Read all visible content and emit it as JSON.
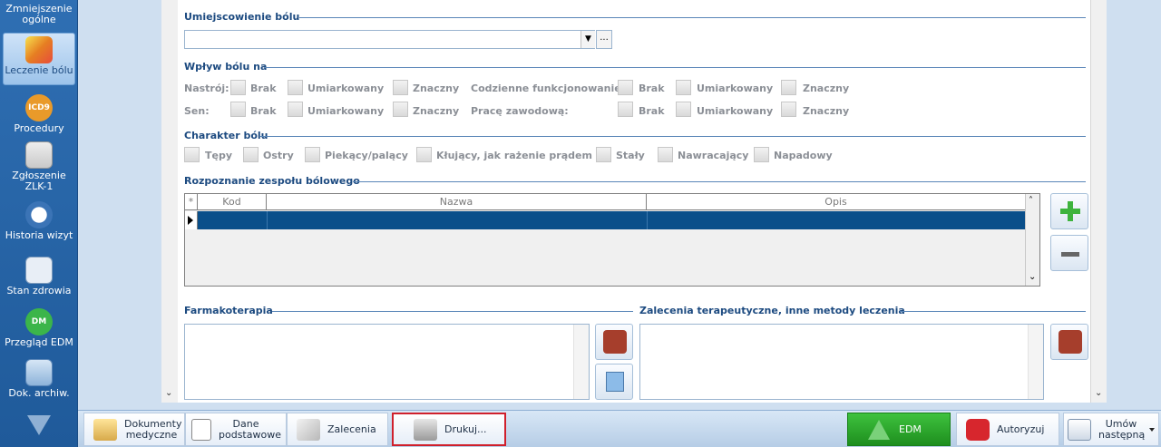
{
  "nav": {
    "items": [
      {
        "label": "Zmniejszenie ogólne"
      },
      {
        "label": "Leczenie bólu"
      },
      {
        "label": "Procedury"
      },
      {
        "label": "Zgłoszenie ZLK-1"
      },
      {
        "label": "Historia wizyt"
      },
      {
        "label": "Stan zdrowia"
      },
      {
        "label": "Przegląd EDM"
      },
      {
        "label": "Dok. archiw."
      }
    ],
    "icon_text": {
      "icd": "ICD9",
      "edm": "DM"
    }
  },
  "section": {
    "location": "Umiejscowienie bólu",
    "impact": "Wpływ bólu na",
    "character": "Charakter bólu",
    "diagnosis": "Rozpoznanie zespołu bólowego",
    "pharma": "Farmakoterapia",
    "recommend": "Zalecenia terapeutyczne, inne metody leczenia"
  },
  "impact": {
    "mood": "Nastrój:",
    "sleep": "Sen:",
    "daily": "Codzienne funkcjonowanie:",
    "work": "Pracę zawodową:",
    "opt_none": "Brak",
    "opt_mod": "Umiarkowany",
    "opt_sig": "Znaczny"
  },
  "character": {
    "opts": [
      "Tępy",
      "Ostry",
      "Piekący/palący",
      "Kłujący, jak rażenie prądem",
      "Stały",
      "Nawracający",
      "Napadowy"
    ]
  },
  "grid": {
    "col_star": "*",
    "col_code": "Kod",
    "col_name": "Nazwa",
    "col_desc": "Opis"
  },
  "combo": {
    "ellipsis": "..."
  },
  "toolbar": {
    "docs": "Dokumenty medyczne",
    "basic": "Dane podstawowe",
    "recs": "Zalecenia",
    "print": "Drukuj...",
    "edm": "EDM",
    "auth": "Autoryzuj",
    "next": "Umów następną"
  },
  "colors": {
    "accent": "#0a4f8a",
    "section": "#1c4a80",
    "focus": "#d0202c",
    "edm": "#1e8e1e"
  }
}
